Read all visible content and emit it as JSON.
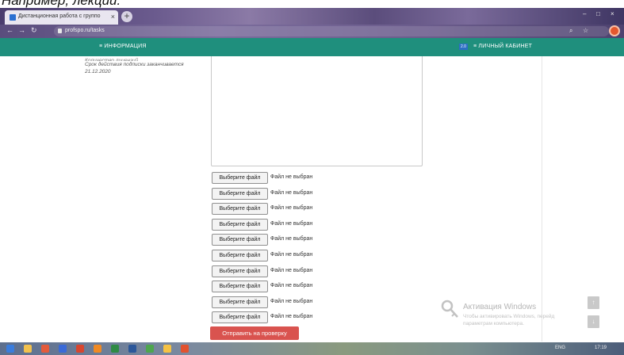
{
  "caption": "Например, лекции.",
  "browser": {
    "tab_title": "Дистанционная работа с группо",
    "tab_close": "×",
    "new_tab": "+",
    "url": "profspo.ru/tasks",
    "window_controls": [
      "–",
      "□",
      "×"
    ]
  },
  "site_header": {
    "info_label": "≡  ИНФОРМАЦИЯ",
    "badge": "2.0",
    "cabinet_label": "≡  ЛИЧНЫЙ КАБИНЕТ"
  },
  "subscription": {
    "line_cut": "Количество лицензий",
    "line1": "Срок действия подписки заканчивается",
    "line2": "21.12.2020"
  },
  "file_inputs": [
    {
      "button": "Выберите файл",
      "status": "Файл не выбран"
    },
    {
      "button": "Выберите файл",
      "status": "Файл не выбран"
    },
    {
      "button": "Выберите файл",
      "status": "Файл не выбран"
    },
    {
      "button": "Выберите файл",
      "status": "Файл не выбран"
    },
    {
      "button": "Выберите файл",
      "status": "Файл не выбран"
    },
    {
      "button": "Выберите файл",
      "status": "Файл не выбран"
    },
    {
      "button": "Выберите файл",
      "status": "Файл не выбран"
    },
    {
      "button": "Выберите файл",
      "status": "Файл не выбран"
    },
    {
      "button": "Выберите файл",
      "status": "Файл не выбран"
    },
    {
      "button": "Выберите файл",
      "status": "Файл не выбран"
    }
  ],
  "submit_label": "Отправить на проверку",
  "watermark": {
    "title": "Активация Windows",
    "line1": "Чтобы активировать Windows, перейд",
    "line2": "параметрам компьютера."
  },
  "scroll": {
    "up": "↑",
    "down": "↓"
  },
  "taskbar": {
    "lang": "ENG",
    "time": "17:19"
  },
  "colors": {
    "header": "#1f8f7d",
    "submit": "#d9534f",
    "badge": "#2c6fc4"
  },
  "icons": [
    "favicon-icon",
    "back-arrow-icon",
    "forward-arrow-icon",
    "reload-icon",
    "lock-icon",
    "search-icon",
    "star-icon",
    "windows-key-icon"
  ]
}
